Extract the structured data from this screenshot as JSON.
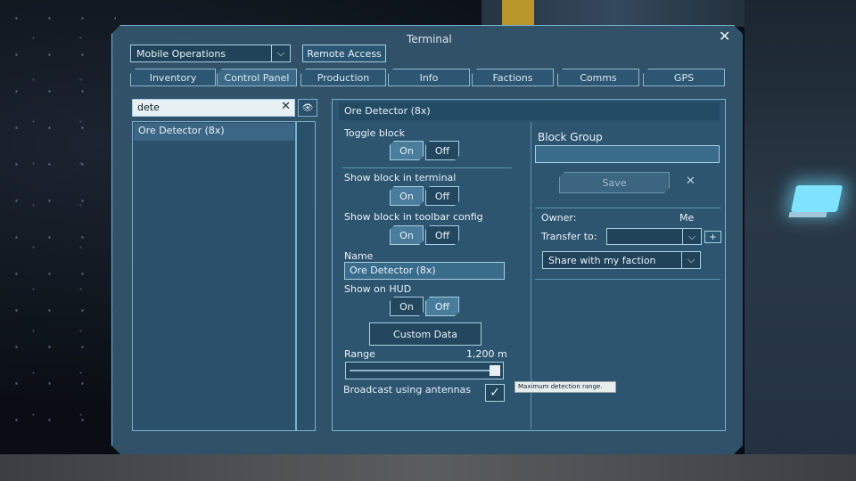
{
  "window": {
    "title": "Terminal"
  },
  "header": {
    "grid_select": "Mobile Operations",
    "remote_access_label": "Remote Access"
  },
  "tabs": [
    {
      "label": "Inventory"
    },
    {
      "label": "Control Panel"
    },
    {
      "label": "Production"
    },
    {
      "label": "Info"
    },
    {
      "label": "Factions"
    },
    {
      "label": "Comms"
    },
    {
      "label": "GPS"
    }
  ],
  "block_list": {
    "search_value": "dete",
    "items": [
      "Ore Detector (8x)"
    ]
  },
  "block": {
    "title": "Ore Detector (8x)",
    "toggle_label": "Toggle block",
    "show_terminal_label": "Show block in terminal",
    "show_toolbar_label": "Show block in toolbar config",
    "on_label": "On",
    "off_label": "Off",
    "name_label": "Name",
    "name_value": "Ore Detector (8x)",
    "show_hud_label": "Show on HUD",
    "custom_data_label": "Custom Data",
    "range_label": "Range",
    "range_value": "1,200 m",
    "range_fraction": 1.0,
    "broadcast_label": "Broadcast using antennas",
    "broadcast_checked": true,
    "tooltip": "Maximum detection range."
  },
  "group": {
    "label": "Block Group",
    "value": "",
    "save_label": "Save"
  },
  "ownership": {
    "owner_label": "Owner:",
    "owner_value": "Me",
    "transfer_label": "Transfer to:",
    "transfer_value": "",
    "share_value": "Share with my faction"
  }
}
